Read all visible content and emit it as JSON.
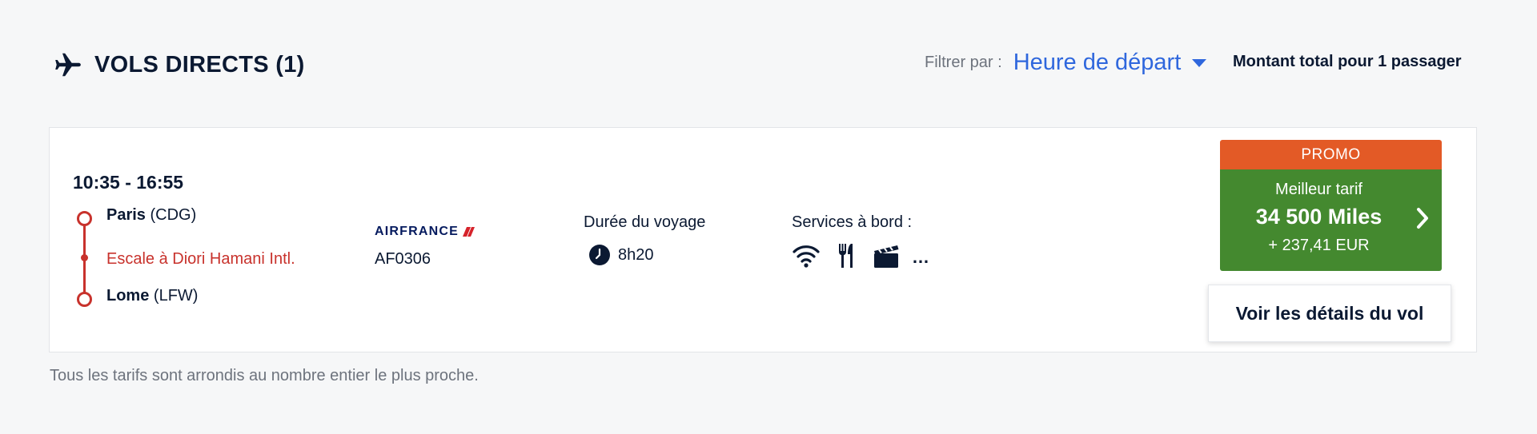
{
  "header": {
    "icon": "airplane-icon",
    "title": "VOLS DIRECTS (1)",
    "filter_label": "Filtrer par :",
    "filter_value": "Heure de départ",
    "total_label": "Montant total pour 1 passager"
  },
  "flight": {
    "times": "10:35 - 16:55",
    "origin_city": "Paris",
    "origin_code": "(CDG)",
    "layover": "Escale à Diori Hamani Intl.",
    "destination_city": "Lome",
    "destination_code": "(LFW)",
    "airline": "AIRFRANCE",
    "flight_number": "AF0306",
    "duration_label": "Durée du voyage",
    "duration": "8h20",
    "services_label": "Services à bord :",
    "services": [
      "wifi-icon",
      "meal-icon",
      "entertainment-icon"
    ],
    "services_more": "…"
  },
  "price": {
    "badge": "PROMO",
    "fare_label": "Meilleur tarif",
    "miles": "34 500  Miles",
    "eur": "+ 237,41 EUR",
    "details_button": "Voir les détails du vol"
  },
  "footnote": "Tous les tarifs sont arrondis au nombre entier le plus proche.",
  "colors": {
    "accent_blue": "#2f67dd",
    "promo_orange": "#e35a26",
    "price_green": "#44892f",
    "route_red": "#c8322c",
    "navy": "#0b1932"
  }
}
